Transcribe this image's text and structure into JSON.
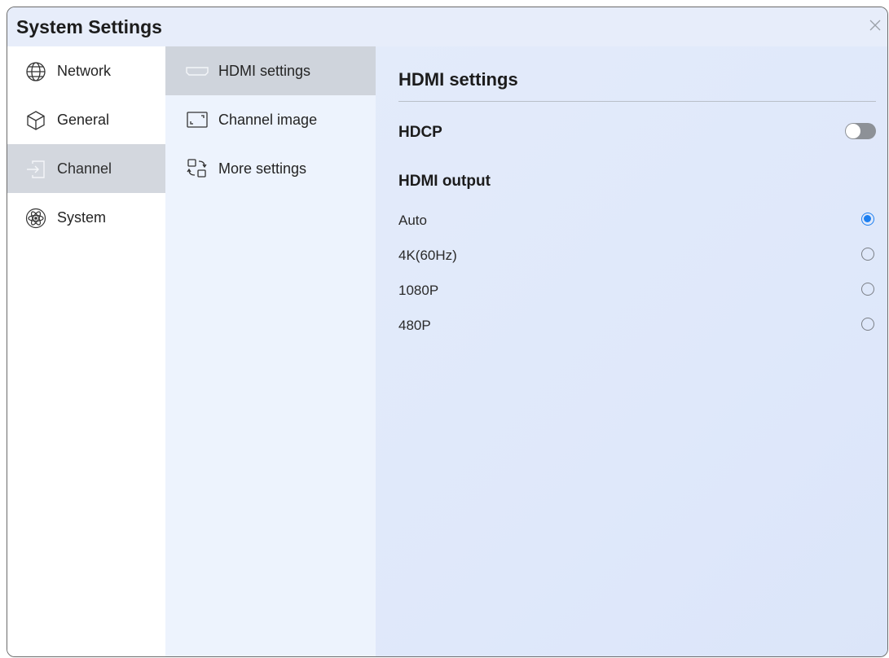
{
  "window": {
    "title": "System Settings",
    "close_icon": "close-icon"
  },
  "sidebar": {
    "items": [
      {
        "label": "Network",
        "icon": "globe-icon",
        "active": false
      },
      {
        "label": "General",
        "icon": "cube-icon",
        "active": false
      },
      {
        "label": "Channel",
        "icon": "input-icon",
        "active": true
      },
      {
        "label": "System",
        "icon": "atom-icon",
        "active": false
      }
    ]
  },
  "submenu": {
    "items": [
      {
        "label": "HDMI settings",
        "icon": "hdmi-icon",
        "active": true
      },
      {
        "label": "Channel image",
        "icon": "frame-icon",
        "active": false
      },
      {
        "label": "More settings",
        "icon": "exchange-icon",
        "active": false
      }
    ]
  },
  "main": {
    "heading": "HDMI settings",
    "hdcp": {
      "label": "HDCP",
      "enabled": false
    },
    "output": {
      "label": "HDMI output",
      "options": [
        {
          "label": "Auto",
          "selected": true
        },
        {
          "label": "4K(60Hz)",
          "selected": false
        },
        {
          "label": "1080P",
          "selected": false
        },
        {
          "label": "480P",
          "selected": false
        }
      ]
    }
  },
  "colors": {
    "accent": "#1d7ff0",
    "active_bg": "#d3d7de"
  }
}
